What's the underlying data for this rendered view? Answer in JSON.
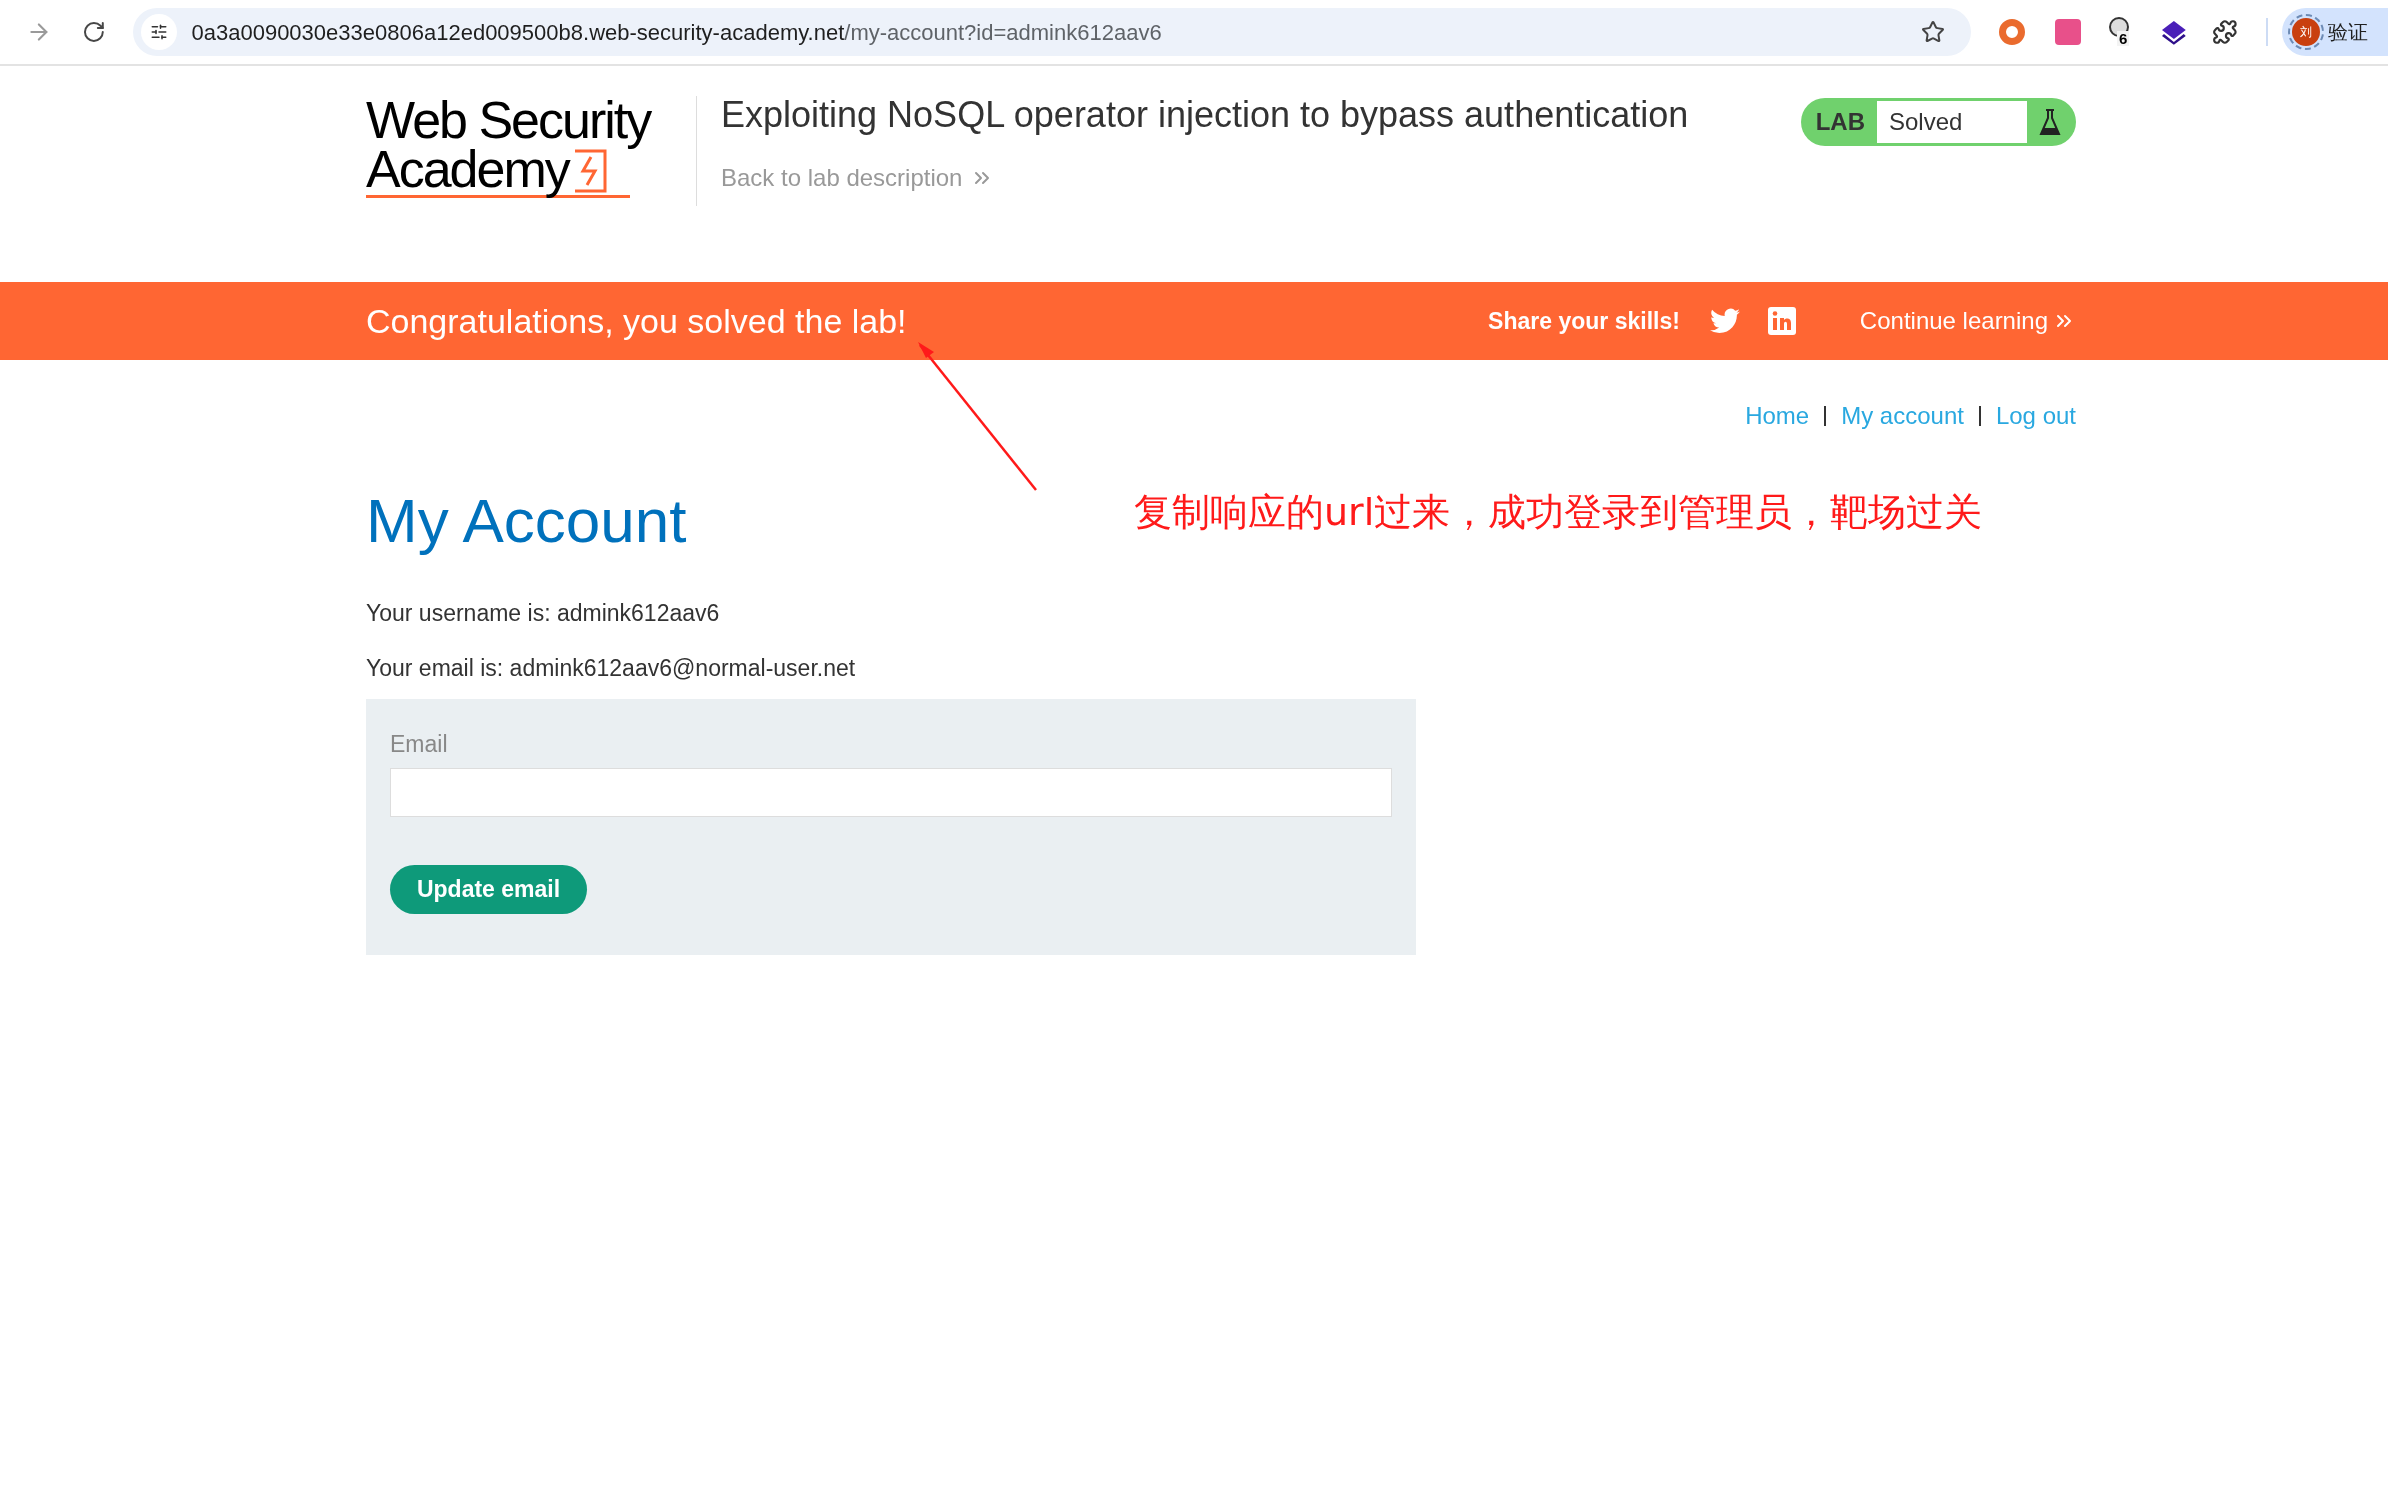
{
  "browser": {
    "url_host": "0a3a0090030e33e0806a12ed009500b8.web-security-academy.net",
    "url_path": "/my-account?id=admink612aav6",
    "extension_badge": "6",
    "avatar_letter": "刘",
    "profile_label": "验证"
  },
  "header": {
    "logo_line_1": "Web Security",
    "logo_line_2": "Academy",
    "title": "Exploiting NoSQL operator injection to bypass authentication",
    "back_link": "Back to lab description",
    "lab_badge": "LAB",
    "status": "Solved"
  },
  "banner": {
    "message": "Congratulations, you solved the lab!",
    "share_label": "Share your skills!",
    "continue_link": "Continue learning"
  },
  "nav": [
    {
      "label": "Home"
    },
    {
      "label": "My account"
    },
    {
      "label": "Log out"
    }
  ],
  "annotation": "复制响应的url过来，成功登录到管理员，靶场过关",
  "account": {
    "heading": "My Account",
    "username_line": "Your username is: admink612aav6",
    "email_line": "Your email is: admink612aav6@normal-user.net",
    "field_label": "Email",
    "button": "Update email"
  }
}
